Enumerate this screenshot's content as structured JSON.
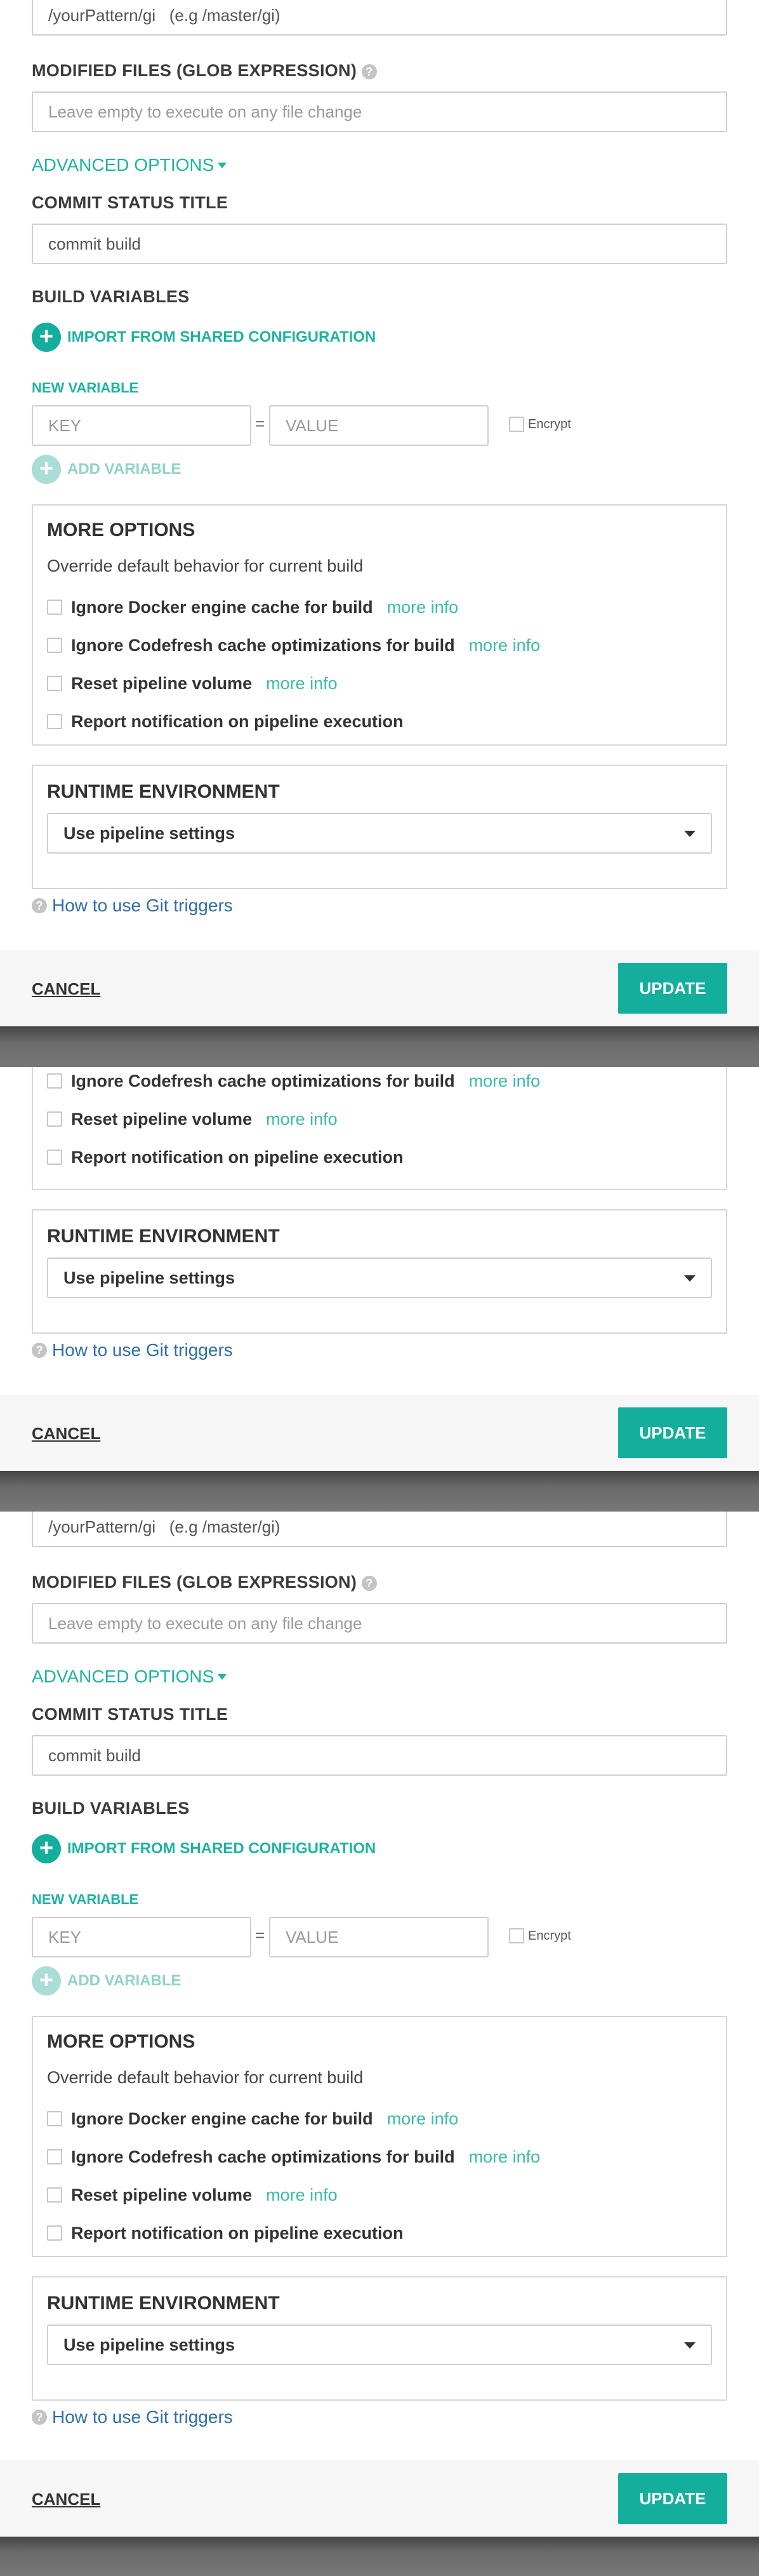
{
  "branch": {
    "value": "/yourPattern/gi",
    "example": "(e.g /master/gi)"
  },
  "modified_files": {
    "label": "MODIFIED FILES (GLOB EXPRESSION)",
    "placeholder": "Leave empty to execute on any file change",
    "help": "?"
  },
  "advanced_options": "ADVANCED OPTIONS",
  "commit_status": {
    "label": "COMMIT STATUS TITLE",
    "value": "commit build"
  },
  "build_variables": {
    "label": "BUILD VARIABLES",
    "import_label": "IMPORT FROM SHARED CONFIGURATION",
    "new_variable_label": "NEW VARIABLE",
    "key_placeholder": "KEY",
    "value_placeholder": "VALUE",
    "equals": "=",
    "encrypt_label": "Encrypt",
    "add_variable_label": "ADD VARIABLE",
    "plus": "+"
  },
  "more_options": {
    "title": "MORE OPTIONS",
    "subtitle": "Override default behavior for current build",
    "items": [
      {
        "label": "Ignore Docker engine cache for build",
        "more_info": "more info"
      },
      {
        "label": "Ignore Codefresh cache optimizations for build",
        "more_info": "more info"
      },
      {
        "label": "Reset pipeline volume",
        "more_info": "more info"
      },
      {
        "label": "Report notification on pipeline execution",
        "more_info": ""
      }
    ]
  },
  "runtime": {
    "title": "RUNTIME ENVIRONMENT",
    "selected": "Use pipeline settings"
  },
  "howto": {
    "label": "How to use Git triggers",
    "icon": "?"
  },
  "footer": {
    "cancel": "CANCEL",
    "update": "UPDATE"
  },
  "colors": {
    "accent": "#14ae9c",
    "link": "#2f6ea6"
  }
}
